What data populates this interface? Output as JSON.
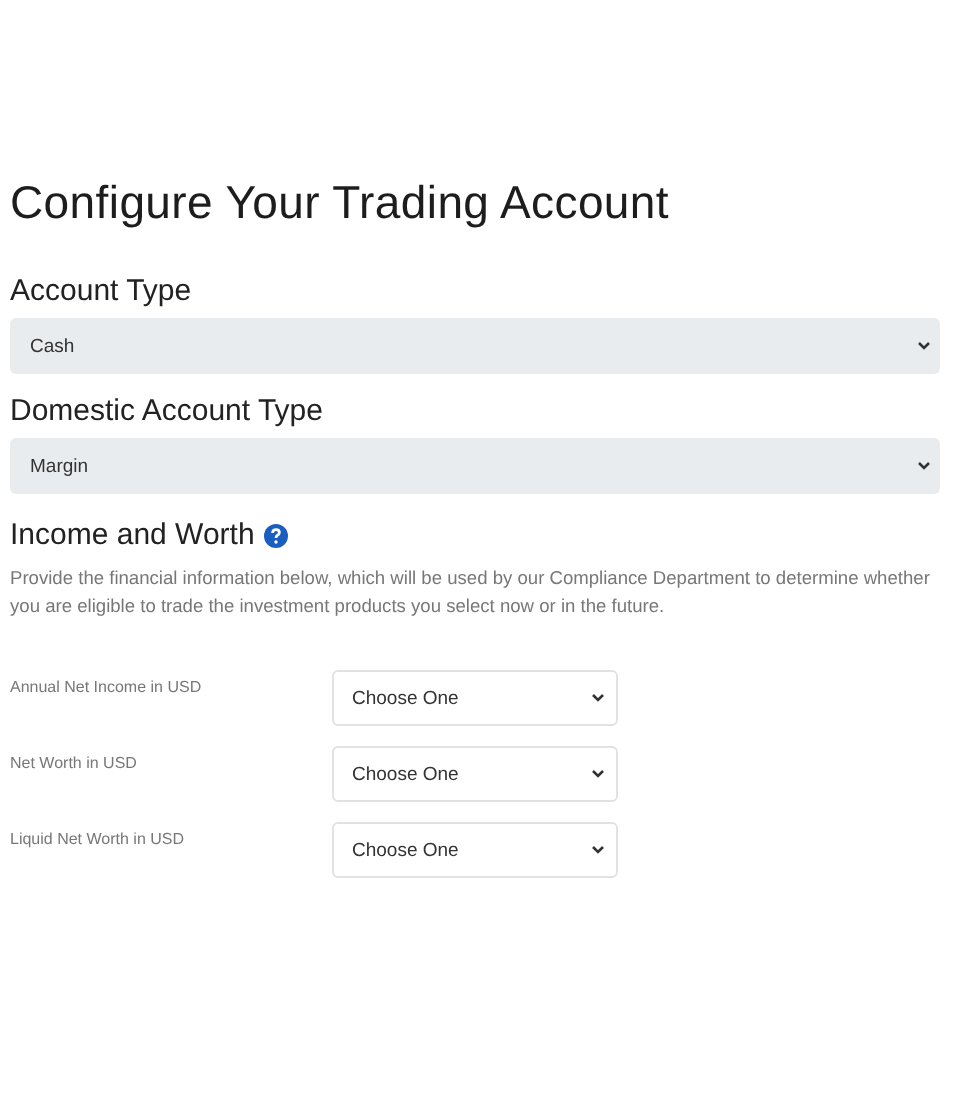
{
  "title": "Configure Your Trading Account",
  "account_fields": [
    {
      "label": "Account Type",
      "value": "Cash"
    },
    {
      "label": "Domestic Account Type",
      "value": "Margin"
    }
  ],
  "income_section": {
    "heading": "Income and Worth",
    "description": "Provide the financial information below, which will be used by our Compliance Department to determine whether you are eligible to trade the investment products you select now or in the future.",
    "rows": [
      {
        "label": "Annual Net Income in USD",
        "value": "Choose One"
      },
      {
        "label": "Net Worth in USD",
        "value": "Choose One"
      },
      {
        "label": "Liquid Net Worth in USD",
        "value": "Choose One"
      }
    ]
  }
}
